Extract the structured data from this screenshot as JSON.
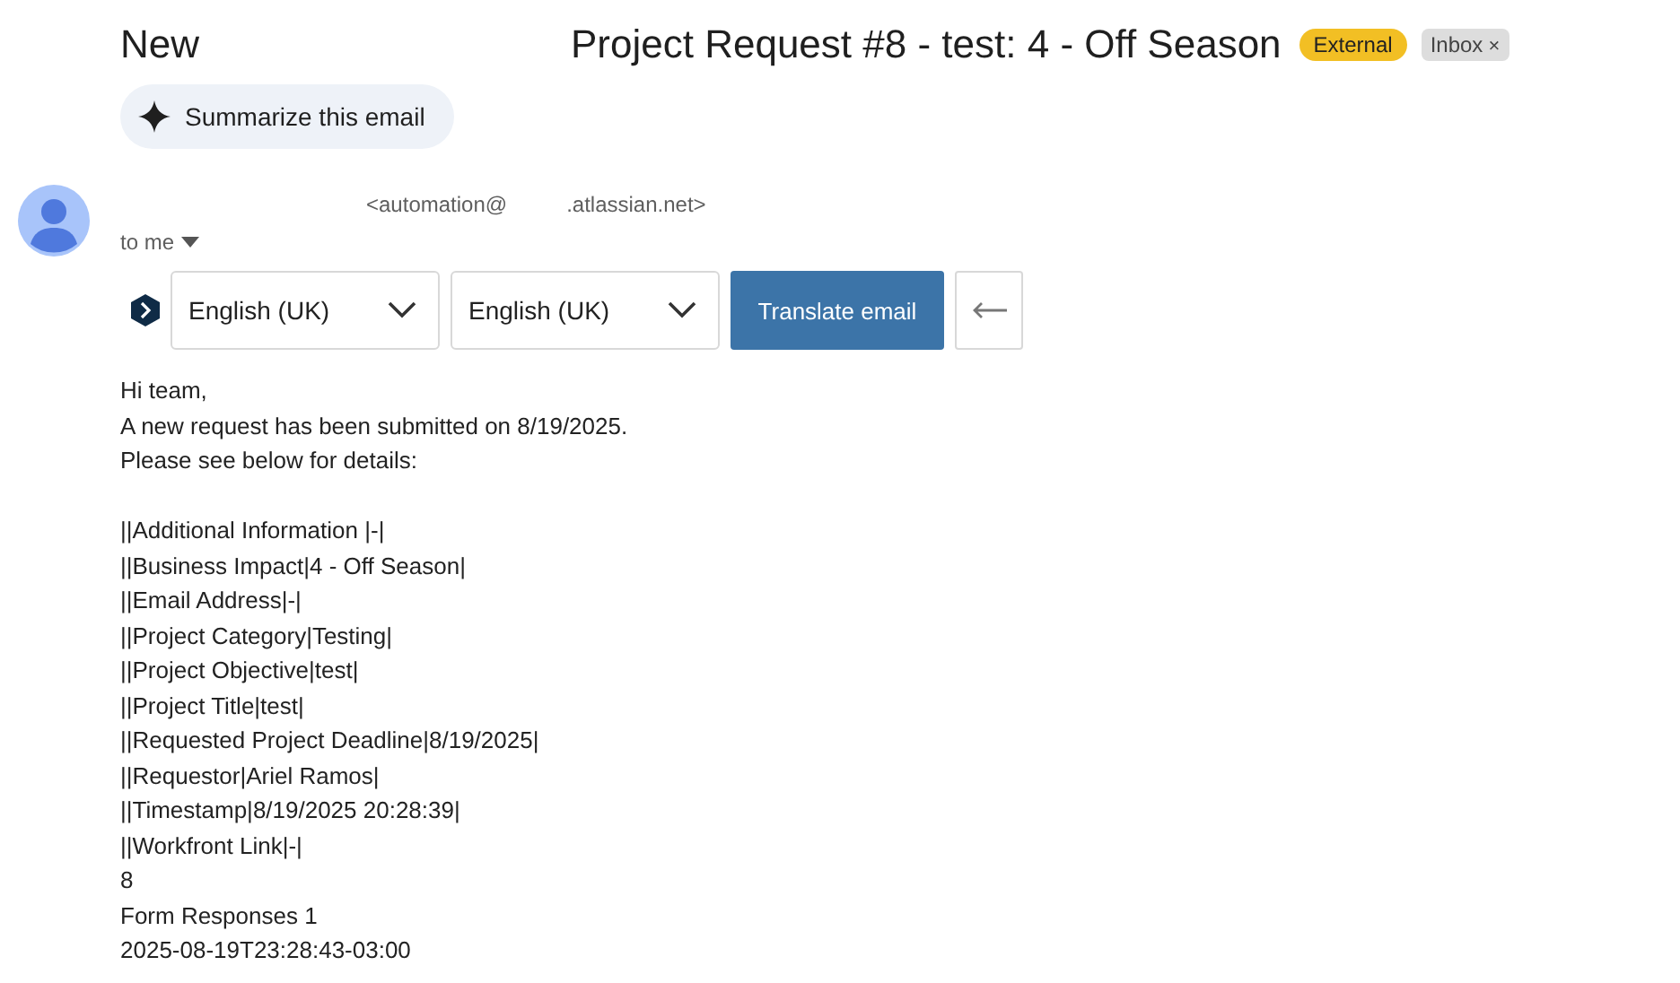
{
  "header": {
    "folder": "New",
    "subject": "Project Request #8 - test: 4 - Off Season",
    "labels": [
      {
        "text": "External",
        "kind": "external"
      },
      {
        "text": "Inbox",
        "kind": "removable",
        "close": "×"
      }
    ]
  },
  "summarize_button": "Summarize this email",
  "sender": {
    "address_start": "<automation@",
    "address_end": ".atlassian.net>",
    "recipient": "to me"
  },
  "translate": {
    "source_language": "English (UK)",
    "target_language": "English (UK)",
    "button": "Translate email"
  },
  "body": {
    "intro": [
      "Hi team,",
      "A new request has been submitted on 8/19/2025.",
      "Please see below for details:"
    ],
    "fields": [
      "||Additional Information |-|",
      "||Business Impact|4 - Off Season|",
      "||Email Address|-|",
      "||Project Category|Testing|",
      "||Project Objective|test|",
      "||Project Title|test|",
      "||Requested Project Deadline|8/19/2025|",
      "||Requestor|Ariel Ramos|",
      "||Timestamp|8/19/2025 20:28:39|",
      "||Workfront Link|-|"
    ],
    "footer": [
      "8",
      "Form Responses 1",
      "2025-08-19T23:28:43-03:00"
    ]
  }
}
